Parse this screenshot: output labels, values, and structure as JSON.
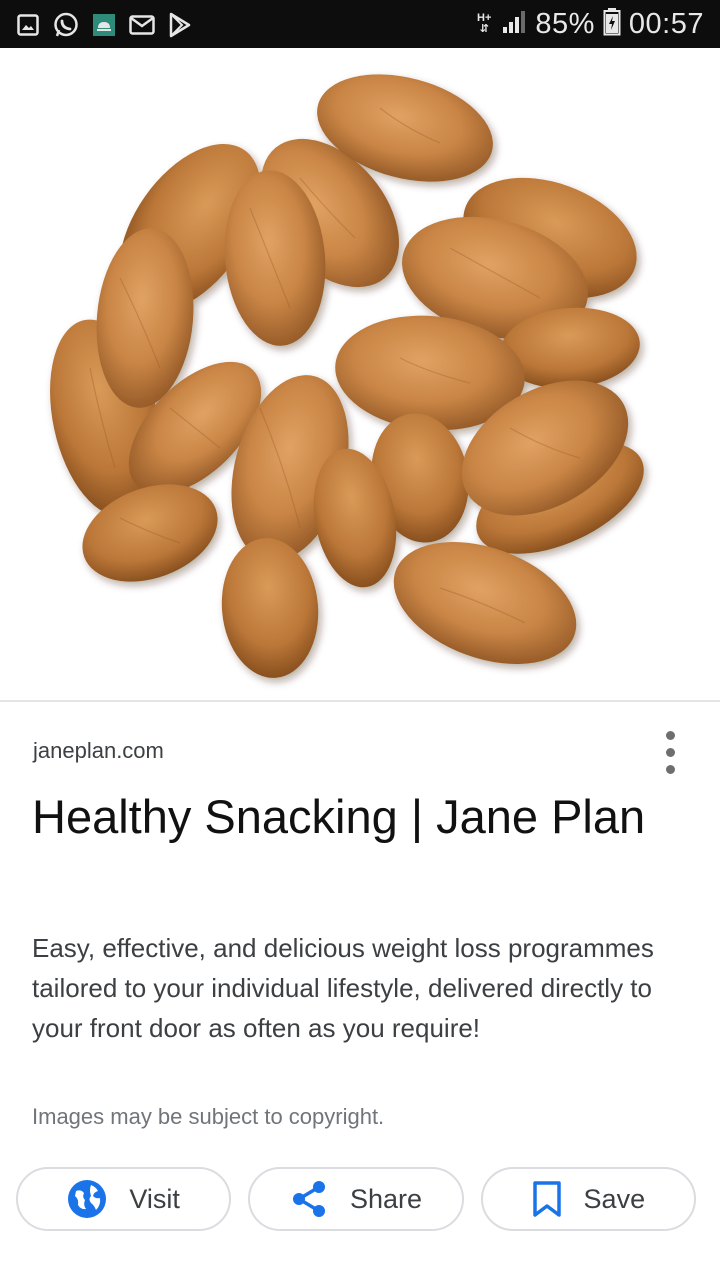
{
  "status_bar": {
    "left_icons": [
      "gallery-icon",
      "whatsapp-icon",
      "android-debug-icon",
      "email-icon",
      "play-store-icon"
    ],
    "network_type": "H+",
    "battery_percent": "85%",
    "time": "00:57"
  },
  "hero_image": {
    "subject": "almonds-image"
  },
  "result": {
    "domain": "janeplan.com",
    "title": "Healthy Snacking | Jane Plan",
    "description": "Easy, effective, and delicious weight loss programmes tailored to your individual lifestyle, delivered directly to your front door as often as you require!",
    "copyright_note": "Images may be subject to copyright."
  },
  "actions": {
    "visit_label": "Visit",
    "share_label": "Share",
    "save_label": "Save"
  },
  "colors": {
    "accent": "#1a73e8",
    "status_bar_bg": "#0d0d0d"
  }
}
